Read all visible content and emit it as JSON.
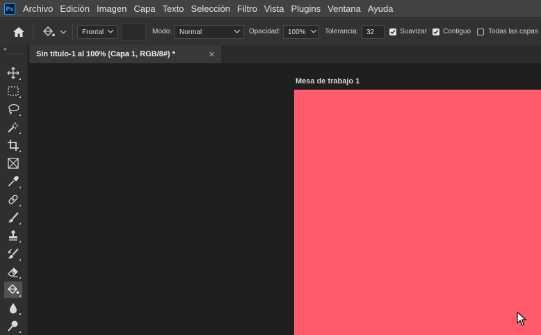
{
  "app": {
    "logo": "Ps"
  },
  "menu": [
    "Archivo",
    "Edición",
    "Imagen",
    "Capa",
    "Texto",
    "Selección",
    "Filtro",
    "Vista",
    "Plugins",
    "Ventana",
    "Ayuda"
  ],
  "options": {
    "fill_source": "Frontal",
    "mode_label": "Modo:",
    "mode_value": "Normal",
    "opacity_label": "Opacidad:",
    "opacity_value": "100%",
    "tolerance_label": "Tolerancia:",
    "tolerance_value": "32",
    "smooth_label": "Suavizar",
    "smooth_checked": true,
    "contiguous_label": "Contiguo",
    "contiguous_checked": true,
    "all_layers_label": "Todas las capas",
    "all_layers_checked": false
  },
  "document": {
    "tab_title": "Sin título-1 al 100% (Capa 1, RGB/8#) *",
    "artboard_name": "Mesa de trabajo 1",
    "artboard_color": "#ff5b6b"
  },
  "toolbar": {
    "collapse_label": "»",
    "tools": [
      {
        "name": "move-icon",
        "active": false
      },
      {
        "name": "marquee-icon",
        "active": false
      },
      {
        "name": "lasso-icon",
        "active": false
      },
      {
        "name": "magic-wand-icon",
        "active": false
      },
      {
        "name": "crop-icon",
        "active": false
      },
      {
        "name": "frame-icon",
        "active": false
      },
      {
        "name": "eyedropper-icon",
        "active": false
      },
      {
        "name": "healing-brush-icon",
        "active": false
      },
      {
        "name": "brush-icon",
        "active": false
      },
      {
        "name": "clone-stamp-icon",
        "active": false
      },
      {
        "name": "history-brush-icon",
        "active": false
      },
      {
        "name": "eraser-icon",
        "active": false
      },
      {
        "name": "paint-bucket-icon",
        "active": true
      },
      {
        "name": "blur-icon",
        "active": false
      },
      {
        "name": "dodge-icon",
        "active": false
      }
    ]
  }
}
